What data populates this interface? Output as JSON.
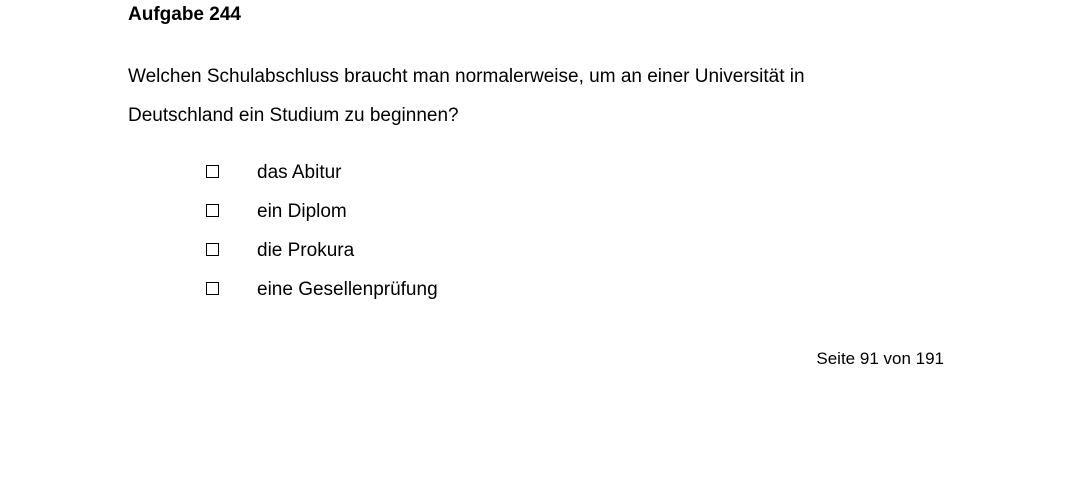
{
  "task": {
    "title": "Aufgabe 244"
  },
  "question": {
    "line1": "Welchen Schulabschluss braucht man normalerweise, um an einer Universität in",
    "line2": "Deutschland ein Studium zu beginnen?"
  },
  "options": [
    {
      "label": "das Abitur",
      "checked": false
    },
    {
      "label": "ein Diplom",
      "checked": false
    },
    {
      "label": "die Prokura",
      "checked": false
    },
    {
      "label": "eine Gesellenprüfung",
      "checked": false
    }
  ],
  "footer": {
    "page": "Seite 91 von 191"
  }
}
